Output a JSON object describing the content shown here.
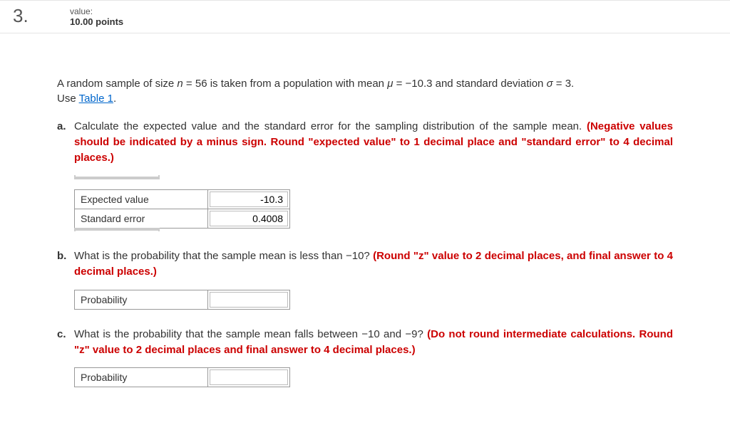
{
  "header": {
    "number": "3.",
    "value_label": "value:",
    "points": "10.00 points"
  },
  "intro": {
    "text_1": "A random sample of size ",
    "n_var": "n",
    "text_2": " = 56 is taken from a population with mean ",
    "mu_var": "μ",
    "text_3": " = −10.3 and standard deviation ",
    "sigma_var": "σ",
    "text_4": " = 3.",
    "use_word": "Use ",
    "table_link": "Table 1",
    "period": "."
  },
  "part_a": {
    "letter": "a.",
    "prompt": "Calculate the expected value and the standard error for the sampling distribution of the sample mean. ",
    "hint": "(Negative values should be indicated by a minus sign. Round \"expected value\" to 1 decimal place and \"standard error\" to 4 decimal places.)",
    "rows": [
      {
        "label": "Expected value",
        "value": "-10.3"
      },
      {
        "label": "Standard error",
        "value": "0.4008"
      }
    ]
  },
  "part_b": {
    "letter": "b.",
    "prompt": "What is the probability that the sample mean is less than −10? ",
    "hint": "(Round \"z\" value to 2 decimal places, and final answer to 4 decimal places.)",
    "rows": [
      {
        "label": "Probability",
        "value": ""
      }
    ]
  },
  "part_c": {
    "letter": "c.",
    "prompt": "What is the probability that the sample mean falls between −10 and −9? ",
    "hint": "(Do not round intermediate calculations. Round \"z\" value to 2 decimal places and final answer to 4 decimal places.)",
    "rows": [
      {
        "label": "Probability",
        "value": ""
      }
    ]
  }
}
